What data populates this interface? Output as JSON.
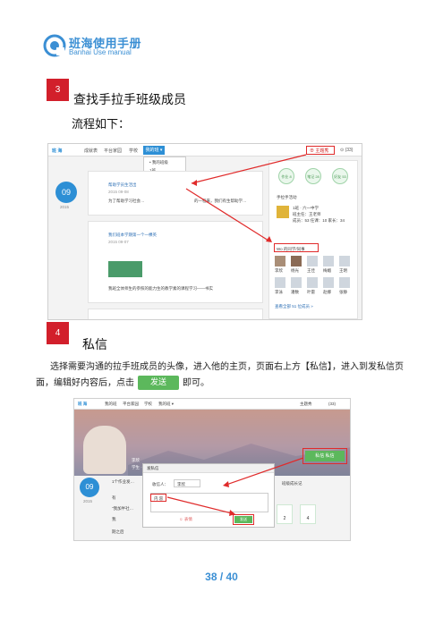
{
  "header": {
    "brand": "班海使用手册",
    "brand_en": "Banhai Use manual"
  },
  "step3": {
    "number": "3",
    "title": "查找手拉手班级成员",
    "subtitle": "流程如下："
  },
  "step4": {
    "number": "4",
    "title": "私信",
    "para_part1": "选择需要沟通的拉手班成员的头像，进入他的主页，页面右上方【私信】，进入到发私信页面，编辑好内容后，点击",
    "send_button": "发送",
    "para_part2": "即可。"
  },
  "shot1": {
    "logo": "班 海",
    "nav": [
      "成就表",
      "平台家园",
      "学校"
    ],
    "nav_active": "我的班 ▾",
    "top_right": "⊕ 主题秀",
    "top_right2": "⊙ (33)",
    "dropdown": [
      "• 我的班级",
      "1班",
      "手拉手班级",
      "1班",
      "初三1班",
      "2013年1班"
    ],
    "date_day": "09",
    "date_year": "2015",
    "post1_title": "帮助学员生活出",
    "post1_date": "2015 09-08",
    "post1_body": "为了帮助学习社会…",
    "post1_extra": "的一程来，我们有生帮助学…",
    "post2_title": "我们班本学期第一个一棵英",
    "post2_date": "2015 09-07",
    "post2_body": "我班全体师生的参照的能力生的教学素的课程学习——书实",
    "circles": [
      "作业 8",
      "笔记 28",
      "好友 53"
    ],
    "hand_section": "手拉手活动",
    "class_name": "1班 · 六一中学",
    "class_teacher": "班主任：王老师",
    "class_stats": "成员：53  任课：10  家长：34",
    "members_title": "Wo 的同学/同事",
    "member_names": [
      "李欣",
      "杨光",
      "王佳",
      "梅媚",
      "王明",
      "李泳",
      "潘数",
      "叶雷",
      "赵娜",
      "张静"
    ],
    "more_link": "查看全部 51 位成员 »"
  },
  "shot2": {
    "logo": "班 海",
    "nav": [
      "我的班",
      "平台家园",
      "学校",
      "我的班 ▾"
    ],
    "top_right": "主题秀",
    "top_right2": "(33)",
    "profile_name": "李欣",
    "profile_info": "学生 · 六一中学 1班 · 关注 123 · 粉丝 32",
    "private_msg": "私信 私信",
    "modal_title": "发私信",
    "recipient_label": "收信人：",
    "recipient": "李欣",
    "content": "内 容",
    "emoji_label": "☺ 表情",
    "send": "发送",
    "date_day": "09",
    "date_year": "2015",
    "feed1": "1个作业发…",
    "feed2": "有",
    "feed3": "\"我加半社…",
    "feed4": "我",
    "feed5": "期之后",
    "right_title": "班级成长记",
    "stats": [
      "2",
      "4"
    ]
  },
  "page": "38 / 40"
}
